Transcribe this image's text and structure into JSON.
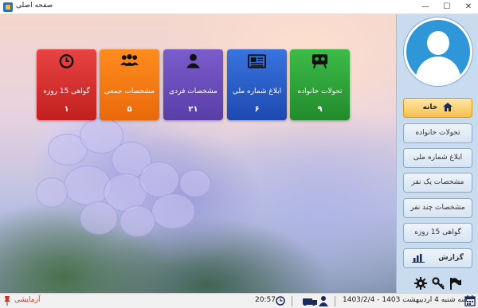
{
  "window": {
    "title": "صفحه اصلی",
    "minimize_glyph": "—",
    "maximize_glyph": "☐",
    "close_glyph": "✕"
  },
  "tiles": [
    {
      "label": "گواهی 15 روزه",
      "count": "١",
      "color": "#d42d2d",
      "icon": "clock-icon"
    },
    {
      "label": "مشخصات جمعی",
      "count": "۵",
      "color": "#f07a10",
      "icon": "group-icon"
    },
    {
      "label": "مشخصات فردی",
      "count": "٢١",
      "color": "#6a4fb6",
      "icon": "person-icon"
    },
    {
      "label": "ابلاغ شماره ملی",
      "count": "۶",
      "color": "#2d60c8",
      "icon": "newspaper-icon"
    },
    {
      "label": "تحولات خانواده",
      "count": "٩",
      "color": "#2ea83a",
      "icon": "family-board-icon"
    }
  ],
  "sidebar": {
    "avatar_icon": "user-avatar-icon",
    "nav": [
      {
        "label": "خانه",
        "icon": "home-icon",
        "active": true
      },
      {
        "label": "تحولات خانواده"
      },
      {
        "label": "ابلاغ شماره ملی"
      },
      {
        "label": "مشخصات یک نفر"
      },
      {
        "label": "مشخصات چند نفر"
      },
      {
        "label": "گواهی 15 روزه"
      },
      {
        "label": "گزارش",
        "icon": "chart-icon"
      }
    ],
    "tools": [
      "settings-icon",
      "key-icon",
      "flag-icon"
    ]
  },
  "status": {
    "mode": "آزمایشی",
    "time": "20:57",
    "date": "سه شنبه 4 اردیبهشت 1403 - 1403/2/4",
    "accent": "#c0392b"
  }
}
